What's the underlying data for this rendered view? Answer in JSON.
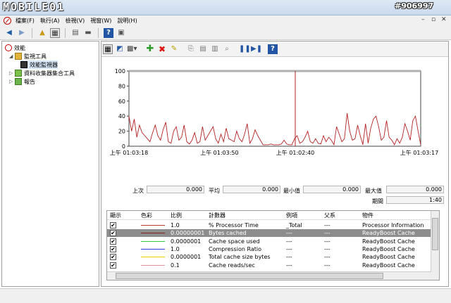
{
  "window": {
    "logo": "MOBILE01",
    "watermark": "#906997"
  },
  "menu": {
    "items": [
      "檔案(F)",
      "執行(A)",
      "檢視(V)",
      "視窗(W)",
      "說明(H)"
    ]
  },
  "tree": {
    "items": [
      {
        "label": "效能",
        "icon": "performance-icon"
      },
      {
        "label": "監視工具",
        "icon": "folder-icon"
      },
      {
        "label": "效能監視器",
        "icon": "chart-icon"
      },
      {
        "label": "資料收集器集合工具",
        "icon": "collector-icon"
      },
      {
        "label": "報告",
        "icon": "report-icon"
      }
    ]
  },
  "graph": {
    "y_ticks": [
      "100",
      "80",
      "60",
      "40",
      "20",
      "0"
    ],
    "x_ticks": [
      "上午 01:03:18",
      "上午 01:03:50",
      "上午 01:02:40",
      "上午 01:03:17"
    ]
  },
  "stats": {
    "last_label": "上次",
    "last_value": "0.000",
    "avg_label": "平均",
    "avg_value": "0.000",
    "min_label": "最小值",
    "min_value": "0.000",
    "max_label": "最大值",
    "max_value": "0.000",
    "duration_label": "期間",
    "duration_value": "1:40"
  },
  "table": {
    "headers": [
      "顯示",
      "色彩",
      "比例",
      "計數器",
      "例項",
      "父系",
      "物件"
    ],
    "rows": [
      {
        "color": "#c0392b",
        "scale": "1.0",
        "counter": "% Processor Time",
        "instance": "_Total",
        "parent": "---",
        "object": "Processor Information",
        "selected": false
      },
      {
        "color": "#8b1a1a",
        "scale": "0.00000001",
        "counter": "Bytes cached",
        "instance": "---",
        "parent": "---",
        "object": "ReadyBoost Cache",
        "selected": true
      },
      {
        "color": "#2ecc40",
        "scale": "0.0000001",
        "counter": "Cache space used",
        "instance": "---",
        "parent": "---",
        "object": "ReadyBoost Cache",
        "selected": false
      },
      {
        "color": "#2c3ed8",
        "scale": "1.0",
        "counter": "Compression Ratio",
        "instance": "---",
        "parent": "---",
        "object": "ReadyBoost Cache",
        "selected": false
      },
      {
        "color": "#e6d600",
        "scale": "0.0000001",
        "counter": "Total cache size bytes",
        "instance": "---",
        "parent": "---",
        "object": "ReadyBoost Cache",
        "selected": false
      },
      {
        "color": "#e58ea0",
        "scale": "0.1",
        "counter": "Cache reads/sec",
        "instance": "---",
        "parent": "---",
        "object": "ReadyBoost Cache",
        "selected": false
      }
    ]
  },
  "chart_data": {
    "type": "line",
    "ylim": [
      0,
      100
    ],
    "series": [
      {
        "color": "#b22222",
        "values": [
          40,
          20,
          36,
          12,
          28,
          18,
          14,
          10,
          6,
          18,
          28,
          14,
          8,
          22,
          32,
          6,
          4,
          20,
          26,
          8,
          12,
          28,
          6,
          3,
          8,
          18,
          4,
          6,
          26,
          8,
          14,
          20,
          26,
          10,
          4,
          16,
          6,
          24,
          10,
          8,
          6,
          20,
          10,
          6,
          16,
          30,
          4,
          10,
          22,
          14,
          8,
          2,
          2,
          2,
          3,
          2,
          2,
          2,
          3,
          8,
          3,
          2,
          2,
          10,
          14,
          4,
          6,
          12,
          20,
          6,
          4,
          10,
          4,
          3,
          14,
          6,
          12,
          8,
          2,
          26,
          16,
          6,
          10,
          44,
          20,
          8,
          10,
          28,
          14,
          2,
          30,
          4,
          24,
          36,
          40,
          26,
          8,
          12,
          34,
          12,
          8,
          2,
          10,
          4,
          12,
          30,
          20,
          8,
          34,
          40,
          20,
          2
        ]
      }
    ]
  }
}
